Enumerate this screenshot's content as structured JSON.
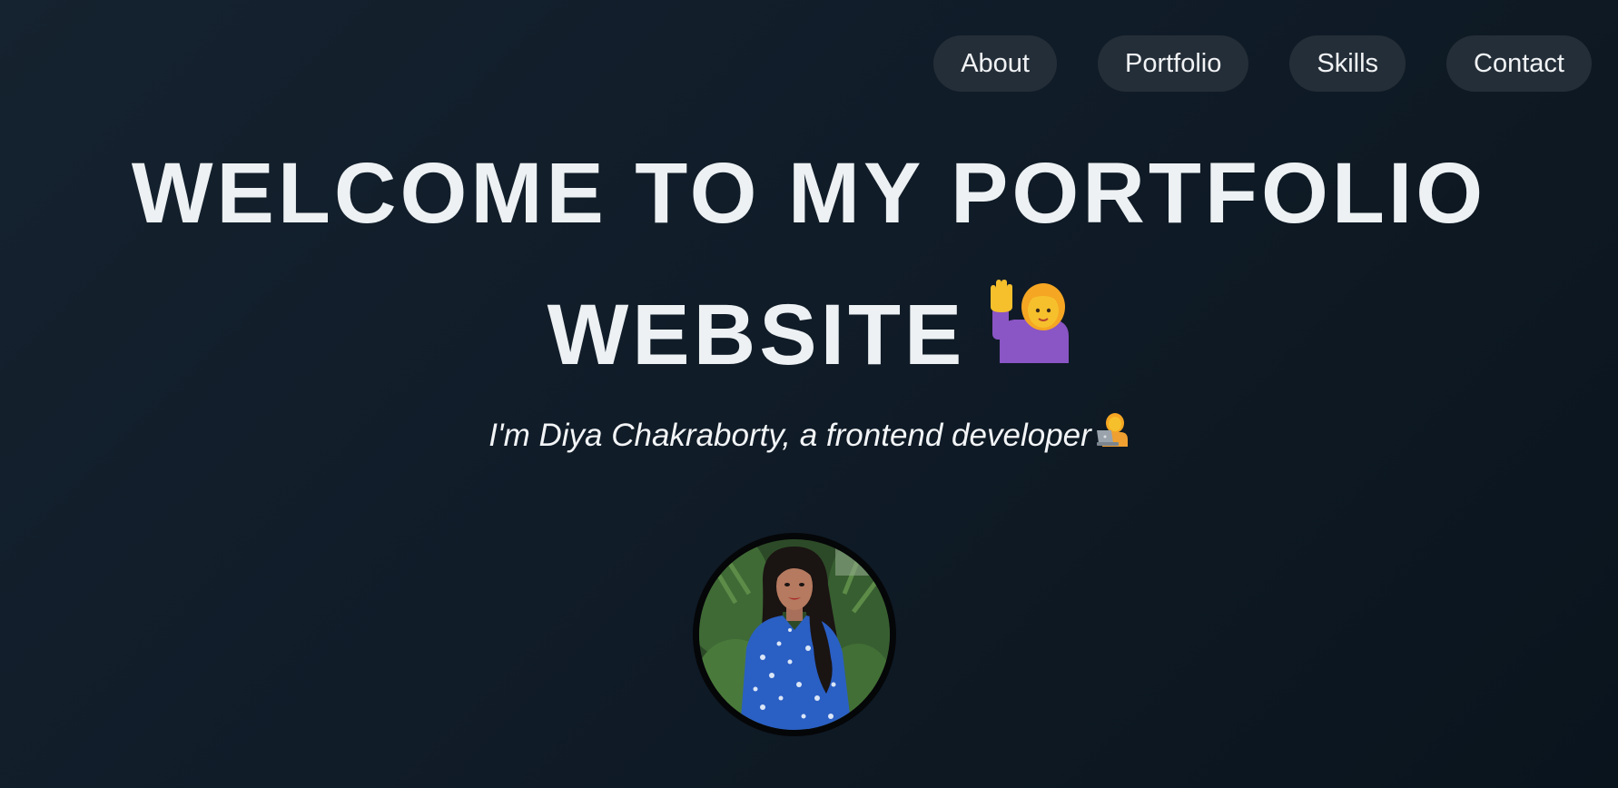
{
  "nav": {
    "items": [
      {
        "label": "About"
      },
      {
        "label": "Portfolio"
      },
      {
        "label": "Skills"
      },
      {
        "label": "Contact"
      }
    ]
  },
  "hero": {
    "title_line1": "WELCOME TO MY PORTFOLIO",
    "title_line2": "WEBSITE",
    "subtitle": "I'm Diya Chakraborty, a frontend developer"
  },
  "icons": {
    "title_emoji": "woman-raising-hand-icon",
    "subtitle_emoji": "woman-technologist-icon"
  },
  "colors": {
    "background": "#111d29",
    "nav_pill": "#242e38",
    "text": "#edf1f3"
  }
}
